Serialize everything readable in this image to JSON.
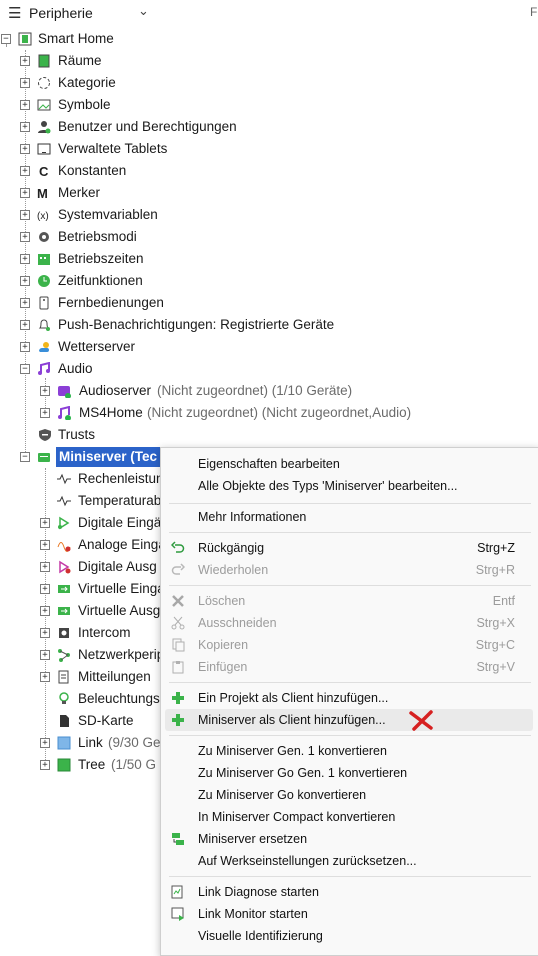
{
  "header": {
    "title": "Peripherie",
    "pin_glyph": "F"
  },
  "tree": {
    "root": "Smart Home",
    "items": [
      {
        "label": "Räume",
        "icon": "rooms-icon"
      },
      {
        "label": "Kategorie",
        "icon": "category-icon"
      },
      {
        "label": "Symbole",
        "icon": "image-icon"
      },
      {
        "label": "Benutzer und Berechtigungen",
        "icon": "users-icon"
      },
      {
        "label": "Verwaltete Tablets",
        "icon": "tablet-icon"
      },
      {
        "label": "Konstanten",
        "icon": "constant-icon"
      },
      {
        "label": "Merker",
        "icon": "marker-icon"
      },
      {
        "label": "Systemvariablen",
        "icon": "variable-icon"
      },
      {
        "label": "Betriebsmodi",
        "icon": "gear-icon"
      },
      {
        "label": "Betriebszeiten",
        "icon": "calendar-icon"
      },
      {
        "label": "Zeitfunktionen",
        "icon": "clock-icon"
      },
      {
        "label": "Fernbedienungen",
        "icon": "remote-icon"
      },
      {
        "label": "Push-Benachrichtigungen: Registrierte Geräte",
        "icon": "bell-icon"
      },
      {
        "label": "Wetterserver",
        "icon": "weather-icon"
      },
      {
        "label": "Audio",
        "icon": "music-icon"
      }
    ],
    "audio_children": [
      {
        "label": "Audioserver",
        "extra": "(Nicht zugeordnet)  (1/10 Geräte)"
      },
      {
        "label": "MS4Home",
        "extra": "(Nicht zugeordnet) (Nicht zugeordnet,Audio)"
      }
    ],
    "trusts": "Trusts",
    "miniserver": "Miniserver (Tec",
    "miniserver_children": [
      {
        "label": "Rechenleistun",
        "icon": "pulse-icon"
      },
      {
        "label": "Temperaturab",
        "icon": "pulse-icon"
      },
      {
        "label": "Digitale Eingä",
        "icon": "digital-input-icon"
      },
      {
        "label": "Analoge Einga",
        "icon": "analog-input-icon"
      },
      {
        "label": "Digitale Ausg",
        "icon": "digital-output-icon"
      },
      {
        "label": "Virtuelle Einga",
        "icon": "virtual-input-icon"
      },
      {
        "label": "Virtuelle Ausg",
        "icon": "virtual-output-icon"
      },
      {
        "label": "Intercom",
        "icon": "intercom-icon"
      },
      {
        "label": "Netzwerkperip",
        "icon": "network-icon"
      },
      {
        "label": "Mitteilungen",
        "icon": "document-icon"
      },
      {
        "label": "Beleuchtungs",
        "icon": "lightbulb-icon"
      },
      {
        "label": "SD-Karte",
        "icon": "sd-card-icon"
      },
      {
        "label": "Link",
        "extra": "(9/30 Ge",
        "icon": "link-icon"
      },
      {
        "label": "Tree",
        "extra": "(1/50 G",
        "icon": "tree-icon"
      }
    ]
  },
  "context_menu": {
    "items": [
      {
        "label": "Eigenschaften bearbeiten",
        "shortcut": ""
      },
      {
        "label": "Alle Objekte des Typs 'Miniserver' bearbeiten...",
        "shortcut": ""
      },
      {
        "label": "Mehr Informationen",
        "shortcut": ""
      },
      {
        "label": "Rückgängig",
        "shortcut": "Strg+Z"
      },
      {
        "label": "Wiederholen",
        "shortcut": "Strg+R"
      },
      {
        "label": "Löschen",
        "shortcut": "Entf"
      },
      {
        "label": "Ausschneiden",
        "shortcut": "Strg+X"
      },
      {
        "label": "Kopieren",
        "shortcut": "Strg+C"
      },
      {
        "label": "Einfügen",
        "shortcut": "Strg+V"
      },
      {
        "label": "Ein Projekt als Client hinzufügen...",
        "shortcut": ""
      },
      {
        "label": "Miniserver als Client hinzufügen...",
        "shortcut": ""
      },
      {
        "label": "Zu Miniserver Gen. 1 konvertieren",
        "shortcut": ""
      },
      {
        "label": "Zu Miniserver Go Gen. 1 konvertieren",
        "shortcut": ""
      },
      {
        "label": "Zu Miniserver Go konvertieren",
        "shortcut": ""
      },
      {
        "label": "In Miniserver Compact konvertieren",
        "shortcut": ""
      },
      {
        "label": "Miniserver ersetzen",
        "shortcut": ""
      },
      {
        "label": "Auf Werkseinstellungen zurücksetzen...",
        "shortcut": ""
      },
      {
        "label": "Link Diagnose starten",
        "shortcut": ""
      },
      {
        "label": "Link Monitor starten",
        "shortcut": ""
      },
      {
        "label": "Visuelle Identifizierung",
        "shortcut": ""
      }
    ]
  },
  "colors": {
    "selection": "#2b63c9",
    "accent_green": "#3bb34a",
    "annotation_red": "#d62020"
  }
}
